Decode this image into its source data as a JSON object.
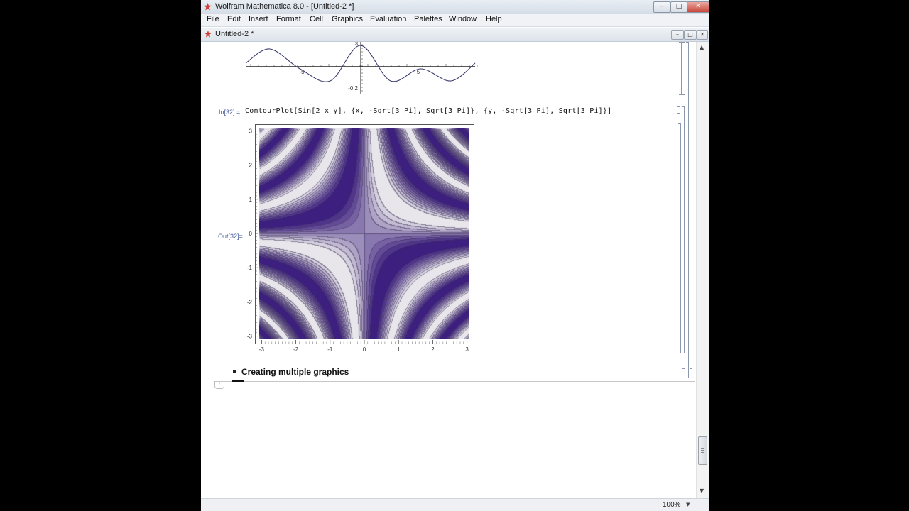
{
  "window": {
    "title": "Wolfram Mathematica 8.0 - [Untitled-2 *]",
    "controls": {
      "minimize": "–",
      "maximize": "□",
      "close": "✕"
    }
  },
  "menu": {
    "items": [
      "File",
      "Edit",
      "Insert",
      "Format",
      "Cell",
      "Graphics",
      "Evaluation",
      "Palettes",
      "Window",
      "Help"
    ]
  },
  "document": {
    "title": "Untitled-2 *"
  },
  "cells": {
    "input_label": "In[32]:=",
    "input_code": "ContourPlot[Sin[2 x y], {x, -Sqrt[3 Pi], Sqrt[3 Pi]}, {y, -Sqrt[3 Pi], Sqrt[3 Pi]}]",
    "output_label": "Out[32]=",
    "section_title": "Creating multiple graphics"
  },
  "status": {
    "zoom": "100%"
  },
  "colors": {
    "dark_purple": "#3d1f7f",
    "mid_purple": "#8f7fc0",
    "light_lavender": "#bfb6de",
    "pale_gray": "#e8e6ea",
    "label_blue": "#4a5e9c"
  },
  "chart_data": [
    {
      "type": "line",
      "title": "",
      "x_ticks": [
        "-5",
        "5"
      ],
      "y_ticks": [
        "0.2",
        "-0.2"
      ],
      "series": [
        {
          "x": [
            -9.5,
            -7.5,
            -5,
            -2.5,
            0,
            2.5,
            5,
            7.5,
            9.5
          ],
          "y": [
            0.05,
            0.25,
            -0.03,
            -0.2,
            0.3,
            -0.2,
            -0.03,
            -0.2,
            0.05
          ]
        }
      ]
    },
    {
      "type": "heatmap",
      "title": "",
      "function": "Sin[2 x y]",
      "x_range": [
        -3.0699801238394655,
        3.0699801238394655
      ],
      "y_range": [
        -3.0699801238394655,
        3.0699801238394655
      ],
      "x_ticks": [
        "-3",
        "-2",
        "-1",
        "0",
        "1",
        "2",
        "3"
      ],
      "y_ticks": [
        "3",
        "2",
        "1",
        "0",
        "-1",
        "-2",
        "-3"
      ],
      "contour_levels": 10
    }
  ]
}
